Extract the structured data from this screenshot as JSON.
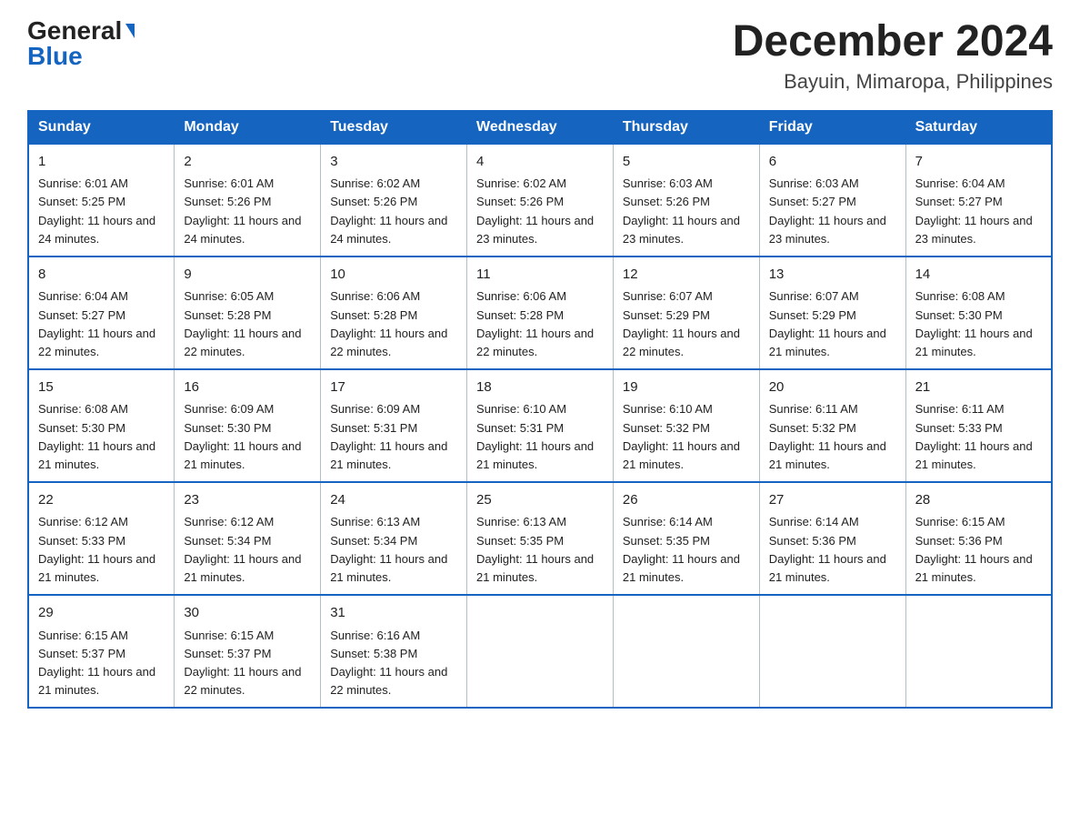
{
  "header": {
    "logo_general": "General",
    "logo_blue": "Blue",
    "month_year": "December 2024",
    "location": "Bayuin, Mimaropa, Philippines"
  },
  "days_of_week": [
    "Sunday",
    "Monday",
    "Tuesday",
    "Wednesday",
    "Thursday",
    "Friday",
    "Saturday"
  ],
  "weeks": [
    [
      {
        "day": "1",
        "sunrise": "6:01 AM",
        "sunset": "5:25 PM",
        "daylight": "11 hours and 24 minutes."
      },
      {
        "day": "2",
        "sunrise": "6:01 AM",
        "sunset": "5:26 PM",
        "daylight": "11 hours and 24 minutes."
      },
      {
        "day": "3",
        "sunrise": "6:02 AM",
        "sunset": "5:26 PM",
        "daylight": "11 hours and 24 minutes."
      },
      {
        "day": "4",
        "sunrise": "6:02 AM",
        "sunset": "5:26 PM",
        "daylight": "11 hours and 23 minutes."
      },
      {
        "day": "5",
        "sunrise": "6:03 AM",
        "sunset": "5:26 PM",
        "daylight": "11 hours and 23 minutes."
      },
      {
        "day": "6",
        "sunrise": "6:03 AM",
        "sunset": "5:27 PM",
        "daylight": "11 hours and 23 minutes."
      },
      {
        "day": "7",
        "sunrise": "6:04 AM",
        "sunset": "5:27 PM",
        "daylight": "11 hours and 23 minutes."
      }
    ],
    [
      {
        "day": "8",
        "sunrise": "6:04 AM",
        "sunset": "5:27 PM",
        "daylight": "11 hours and 22 minutes."
      },
      {
        "day": "9",
        "sunrise": "6:05 AM",
        "sunset": "5:28 PM",
        "daylight": "11 hours and 22 minutes."
      },
      {
        "day": "10",
        "sunrise": "6:06 AM",
        "sunset": "5:28 PM",
        "daylight": "11 hours and 22 minutes."
      },
      {
        "day": "11",
        "sunrise": "6:06 AM",
        "sunset": "5:28 PM",
        "daylight": "11 hours and 22 minutes."
      },
      {
        "day": "12",
        "sunrise": "6:07 AM",
        "sunset": "5:29 PM",
        "daylight": "11 hours and 22 minutes."
      },
      {
        "day": "13",
        "sunrise": "6:07 AM",
        "sunset": "5:29 PM",
        "daylight": "11 hours and 21 minutes."
      },
      {
        "day": "14",
        "sunrise": "6:08 AM",
        "sunset": "5:30 PM",
        "daylight": "11 hours and 21 minutes."
      }
    ],
    [
      {
        "day": "15",
        "sunrise": "6:08 AM",
        "sunset": "5:30 PM",
        "daylight": "11 hours and 21 minutes."
      },
      {
        "day": "16",
        "sunrise": "6:09 AM",
        "sunset": "5:30 PM",
        "daylight": "11 hours and 21 minutes."
      },
      {
        "day": "17",
        "sunrise": "6:09 AM",
        "sunset": "5:31 PM",
        "daylight": "11 hours and 21 minutes."
      },
      {
        "day": "18",
        "sunrise": "6:10 AM",
        "sunset": "5:31 PM",
        "daylight": "11 hours and 21 minutes."
      },
      {
        "day": "19",
        "sunrise": "6:10 AM",
        "sunset": "5:32 PM",
        "daylight": "11 hours and 21 minutes."
      },
      {
        "day": "20",
        "sunrise": "6:11 AM",
        "sunset": "5:32 PM",
        "daylight": "11 hours and 21 minutes."
      },
      {
        "day": "21",
        "sunrise": "6:11 AM",
        "sunset": "5:33 PM",
        "daylight": "11 hours and 21 minutes."
      }
    ],
    [
      {
        "day": "22",
        "sunrise": "6:12 AM",
        "sunset": "5:33 PM",
        "daylight": "11 hours and 21 minutes."
      },
      {
        "day": "23",
        "sunrise": "6:12 AM",
        "sunset": "5:34 PM",
        "daylight": "11 hours and 21 minutes."
      },
      {
        "day": "24",
        "sunrise": "6:13 AM",
        "sunset": "5:34 PM",
        "daylight": "11 hours and 21 minutes."
      },
      {
        "day": "25",
        "sunrise": "6:13 AM",
        "sunset": "5:35 PM",
        "daylight": "11 hours and 21 minutes."
      },
      {
        "day": "26",
        "sunrise": "6:14 AM",
        "sunset": "5:35 PM",
        "daylight": "11 hours and 21 minutes."
      },
      {
        "day": "27",
        "sunrise": "6:14 AM",
        "sunset": "5:36 PM",
        "daylight": "11 hours and 21 minutes."
      },
      {
        "day": "28",
        "sunrise": "6:15 AM",
        "sunset": "5:36 PM",
        "daylight": "11 hours and 21 minutes."
      }
    ],
    [
      {
        "day": "29",
        "sunrise": "6:15 AM",
        "sunset": "5:37 PM",
        "daylight": "11 hours and 21 minutes."
      },
      {
        "day": "30",
        "sunrise": "6:15 AM",
        "sunset": "5:37 PM",
        "daylight": "11 hours and 22 minutes."
      },
      {
        "day": "31",
        "sunrise": "6:16 AM",
        "sunset": "5:38 PM",
        "daylight": "11 hours and 22 minutes."
      },
      null,
      null,
      null,
      null
    ]
  ]
}
